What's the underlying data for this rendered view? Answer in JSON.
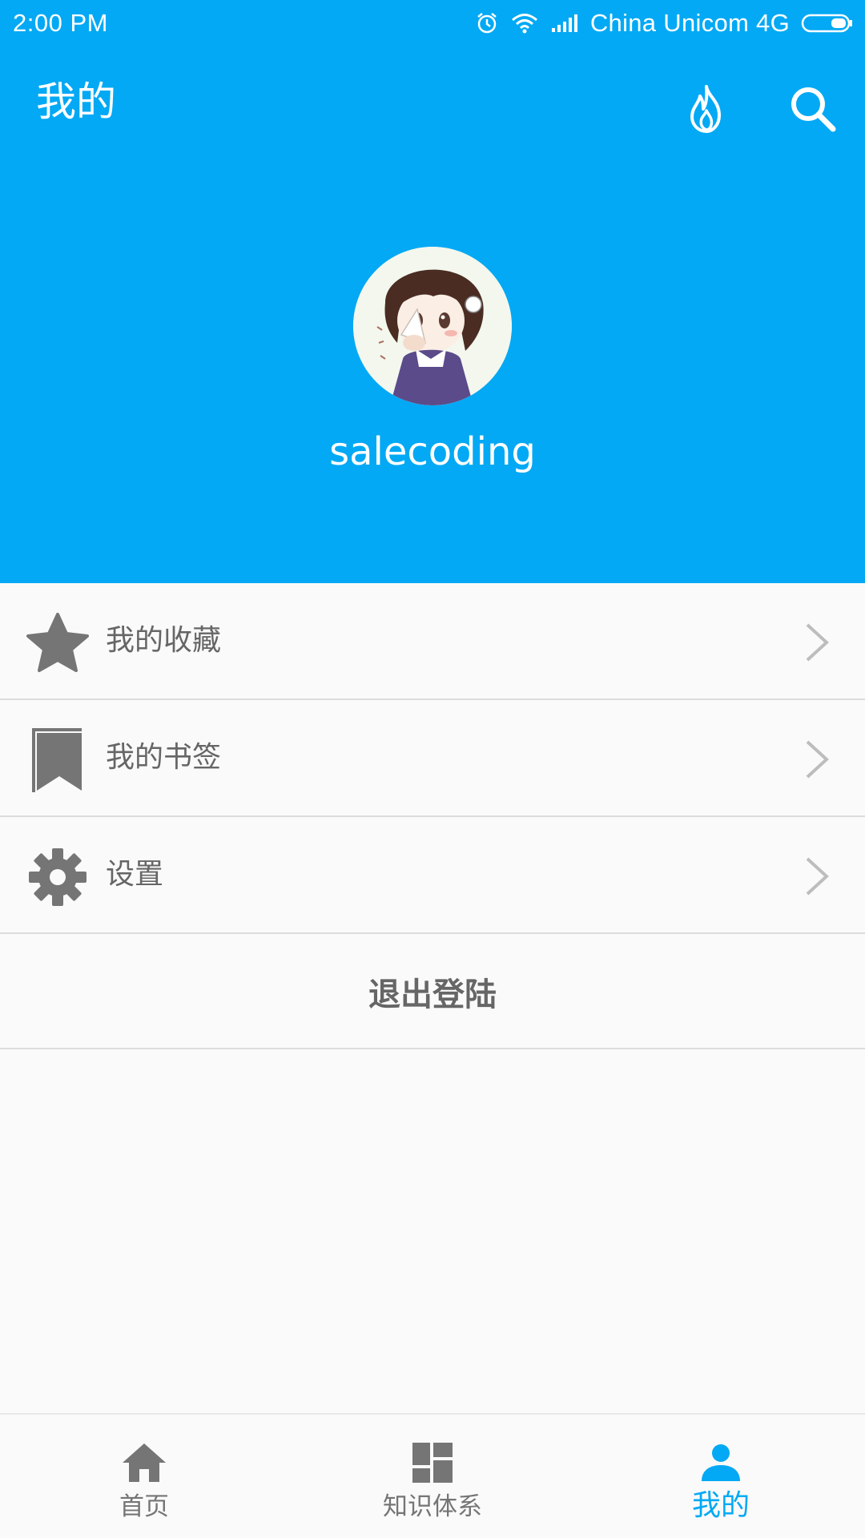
{
  "status_bar": {
    "time": "2:00 PM",
    "carrier": "China Unicom 4G",
    "icons": [
      "alarm-icon",
      "wifi-icon",
      "signal-icon",
      "battery-icon"
    ]
  },
  "toolbar": {
    "title": "我的",
    "actions": [
      "hot-icon",
      "search-icon"
    ]
  },
  "profile": {
    "username": "salecoding"
  },
  "menu": {
    "items": [
      {
        "label": "我的收藏",
        "icon": "star-icon"
      },
      {
        "label": "我的书签",
        "icon": "bookmark-icon"
      },
      {
        "label": "设置",
        "icon": "gear-icon"
      }
    ],
    "logout_label": "退出登陆"
  },
  "bottom_nav": {
    "items": [
      {
        "label": "首页",
        "icon": "home-icon",
        "active": false
      },
      {
        "label": "知识体系",
        "icon": "dashboard-icon",
        "active": false
      },
      {
        "label": "我的",
        "icon": "person-icon",
        "active": true
      }
    ]
  },
  "colors": {
    "primary": "#03a9f4",
    "text_secondary": "#666666",
    "icon_gray": "#757575",
    "divider": "#dcdcdc"
  }
}
